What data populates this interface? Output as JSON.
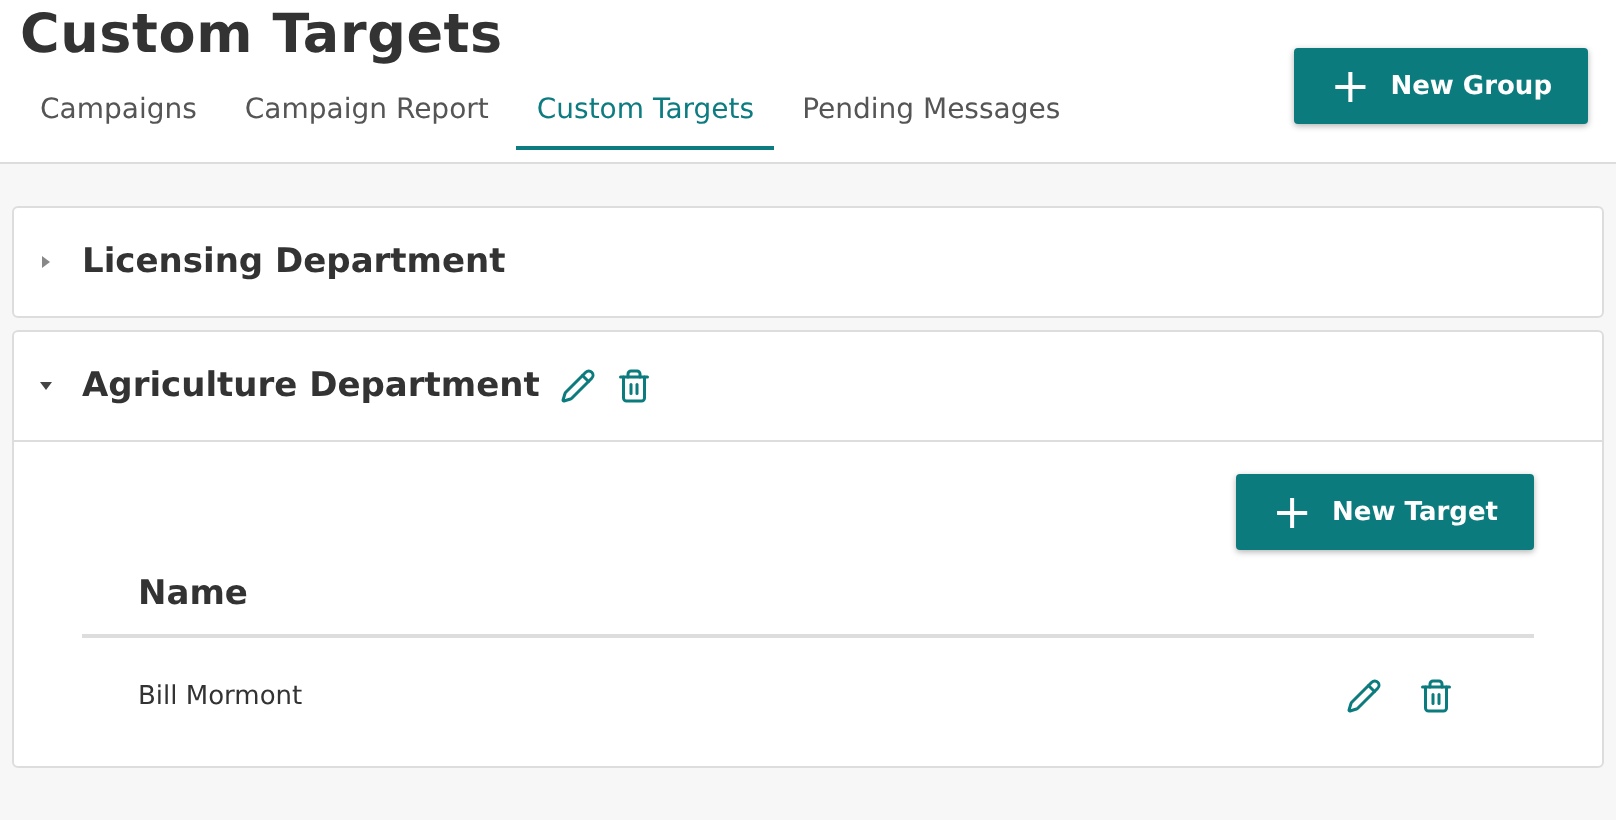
{
  "page": {
    "title": "Custom Targets"
  },
  "tabs": [
    {
      "label": "Campaigns",
      "selected": false
    },
    {
      "label": "Campaign Report",
      "selected": false
    },
    {
      "label": "Custom Targets",
      "selected": true
    },
    {
      "label": "Pending Messages",
      "selected": false
    }
  ],
  "new_group_button": {
    "icon": "+",
    "label": "New Group"
  },
  "groups": [
    {
      "name": "Licensing Department",
      "expanded": false
    },
    {
      "name": "Agriculture Department",
      "expanded": true,
      "new_target_button": {
        "icon": "+",
        "label": "New Target"
      },
      "table": {
        "columns": [
          "Name"
        ],
        "rows": [
          {
            "name": "Bill Mormont"
          }
        ]
      }
    }
  ]
}
